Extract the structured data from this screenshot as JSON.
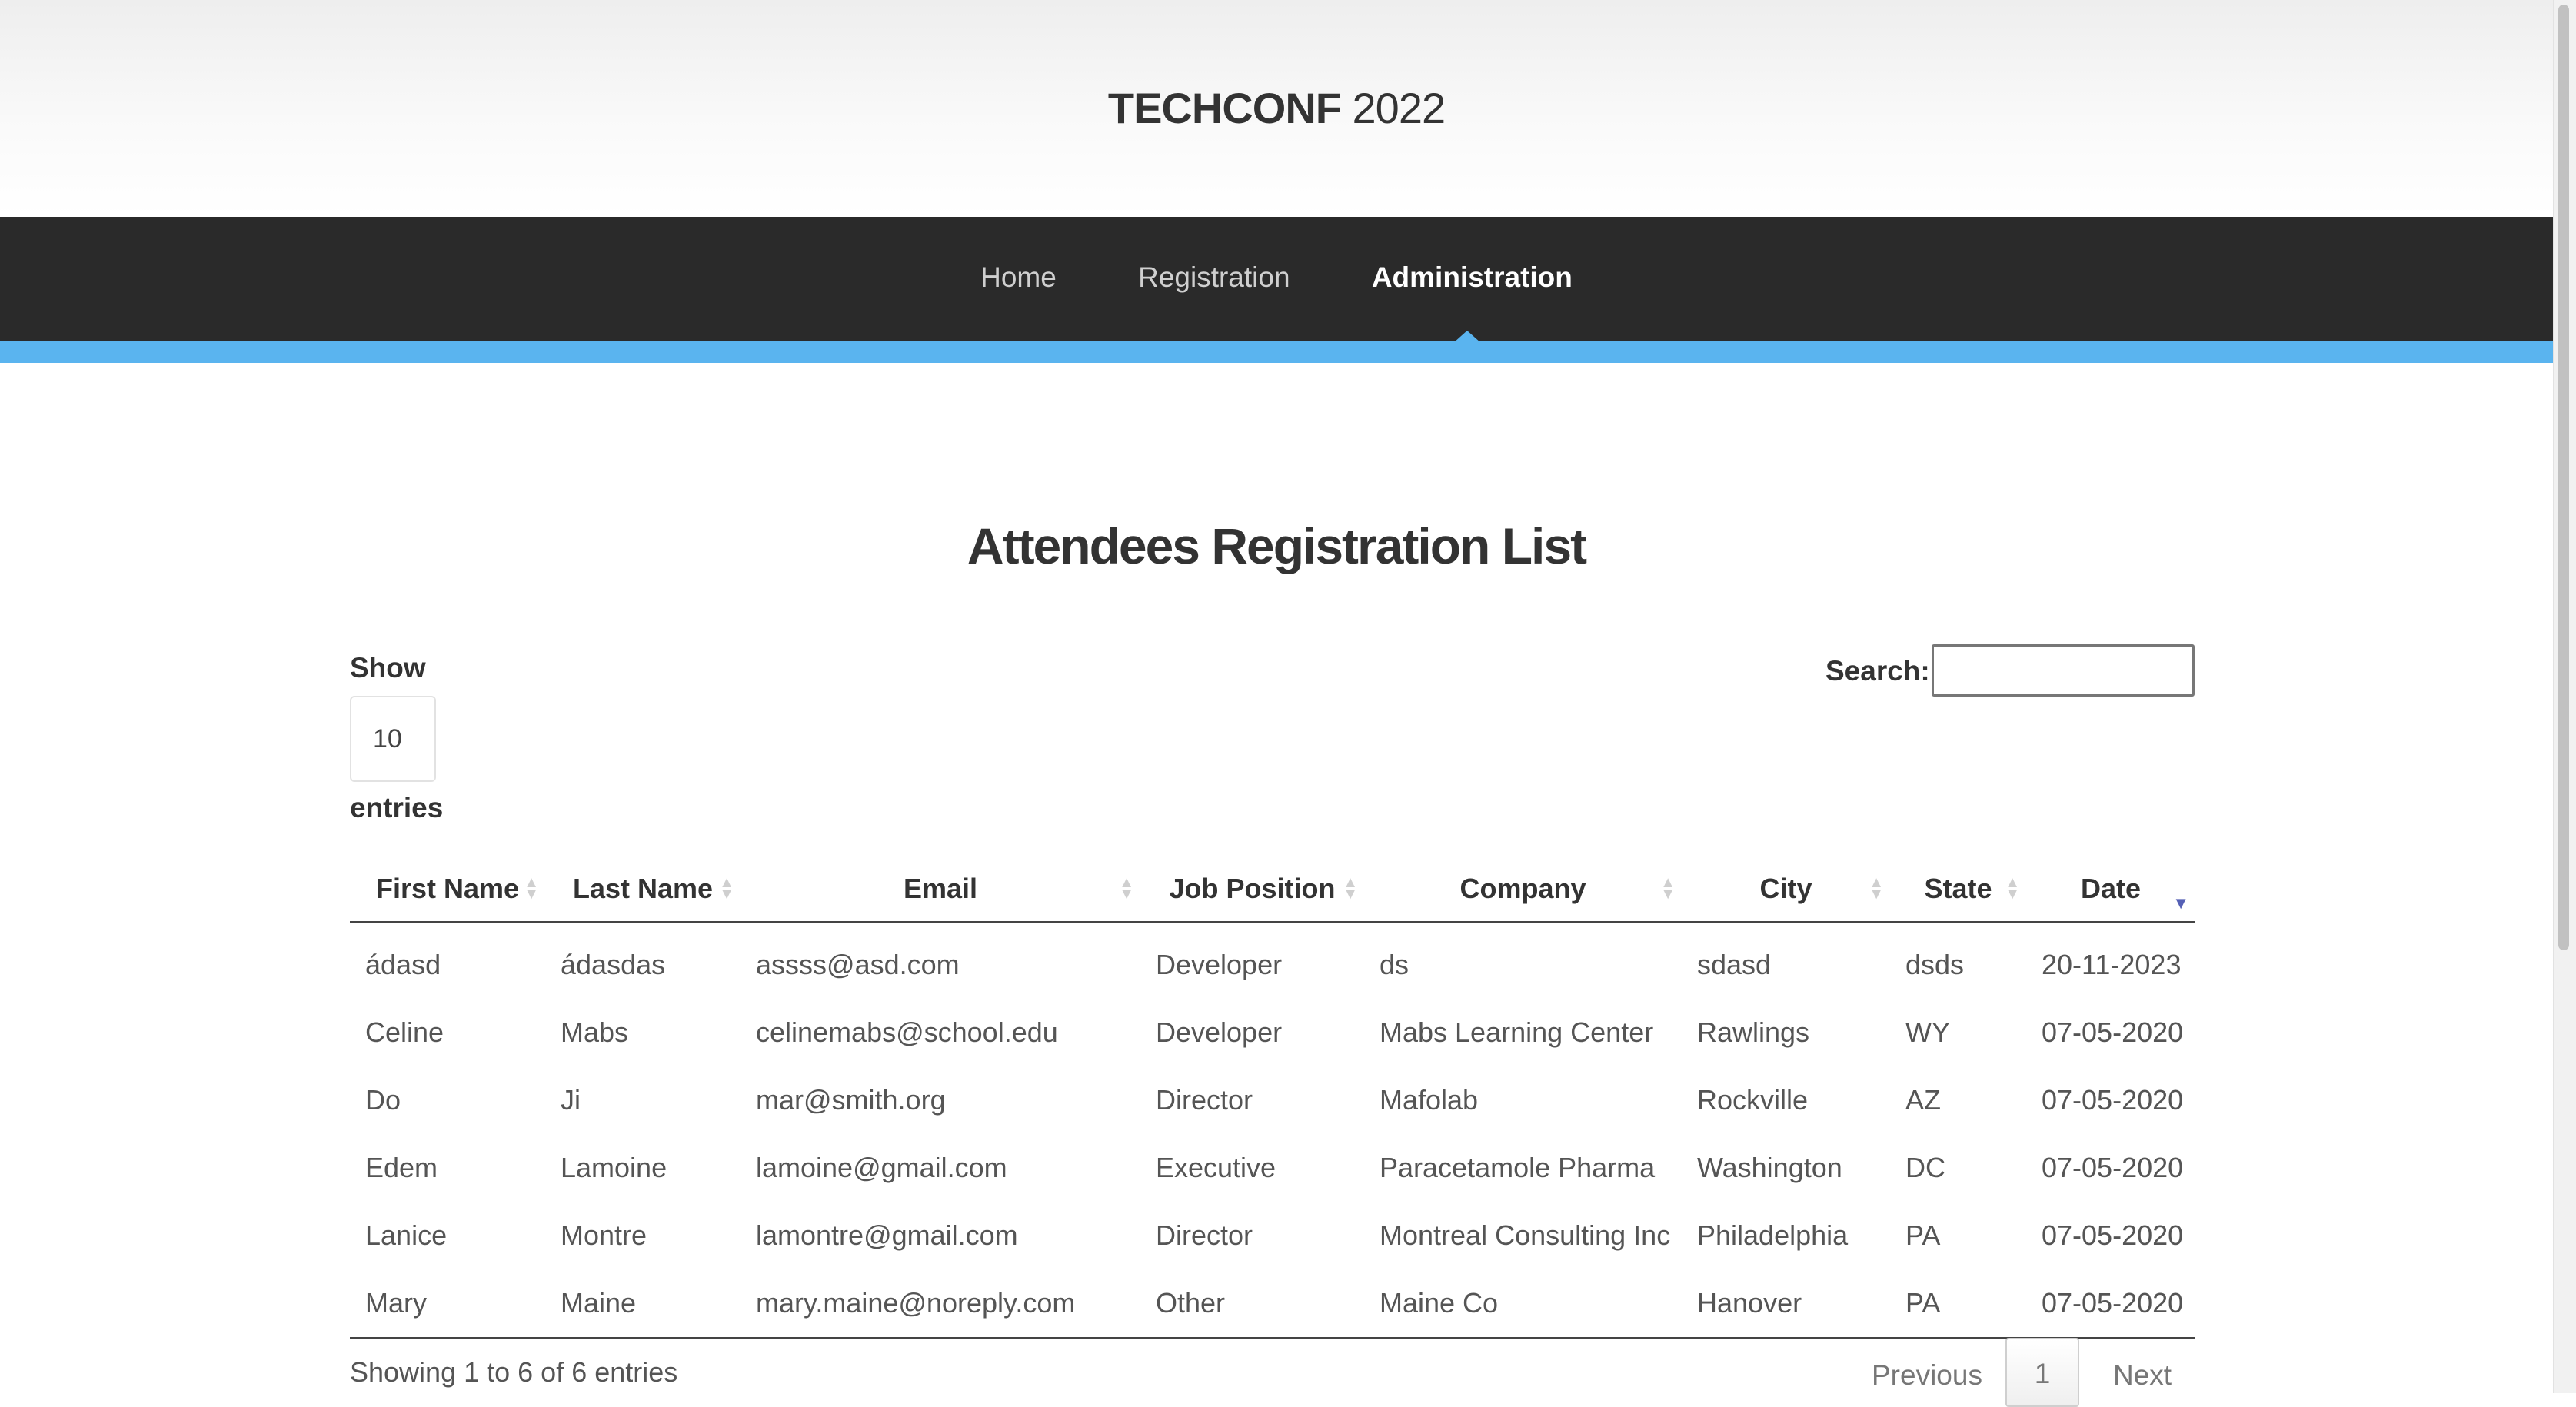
{
  "brand": {
    "bold": "TECHCONF",
    "year": "2022"
  },
  "nav": {
    "home": "Home",
    "registration": "Registration",
    "administration": "Administration"
  },
  "page": {
    "title": "Attendees Registration List"
  },
  "controls": {
    "show_label": "Show",
    "page_size": "10",
    "entries_label": "entries",
    "search_label": "Search:",
    "search_value": ""
  },
  "table": {
    "columns": [
      "First Name",
      "Last Name",
      "Email",
      "Job Position",
      "Company",
      "City",
      "State",
      "Date"
    ],
    "sorted_column": "Date",
    "sort_direction": "descending",
    "rows": [
      [
        "ádasd",
        "ádasdas",
        "assss@asd.com",
        "Developer",
        "ds",
        "sdasd",
        "dsds",
        "20-11-2023"
      ],
      [
        "Celine",
        "Mabs",
        "celinemabs@school.edu",
        "Developer",
        "Mabs Learning Center",
        "Rawlings",
        "WY",
        "07-05-2020"
      ],
      [
        "Do",
        "Ji",
        "mar@smith.org",
        "Director",
        "Mafolab",
        "Rockville",
        "AZ",
        "07-05-2020"
      ],
      [
        "Edem",
        "Lamoine",
        "lamoine@gmail.com",
        "Executive",
        "Paracetamole Pharma",
        "Washington",
        "DC",
        "07-05-2020"
      ],
      [
        "Lanice",
        "Montre",
        "lamontre@gmail.com",
        "Director",
        "Montreal Consulting Inc",
        "Philadelphia",
        "PA",
        "07-05-2020"
      ],
      [
        "Mary",
        "Maine",
        "mary.maine@noreply.com",
        "Other",
        "Maine Co",
        "Hanover",
        "PA",
        "07-05-2020"
      ]
    ]
  },
  "footer": {
    "info": "Showing 1 to 6 of 6 entries",
    "previous": "Previous",
    "page": "1",
    "next": "Next"
  },
  "colors": {
    "accent": "#5ab4ef",
    "nav_bg": "#2a2a2a",
    "sort_active": "#5560b5"
  }
}
